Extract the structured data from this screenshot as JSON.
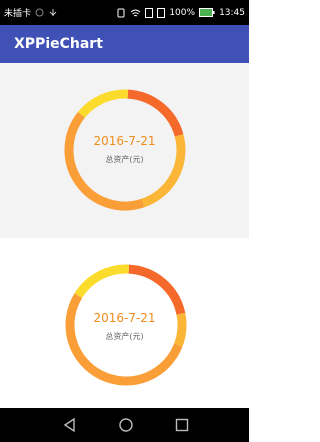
{
  "status_bar": {
    "carrier": "未插卡",
    "battery": "100%",
    "time": "13:45"
  },
  "app_bar": {
    "title": "XPPieChart"
  },
  "charts": [
    {
      "center_title": "2016-7-21",
      "center_subtitle": "总资产(元)",
      "slices": [
        {
          "value": 0.2,
          "color": "#f5692a"
        },
        {
          "value": 0.24,
          "color": "#fbb637"
        },
        {
          "value": 0.41,
          "color": "#fa9f38"
        },
        {
          "value": 0.15,
          "color": "#fbdb2c"
        }
      ]
    },
    {
      "center_title": "2016-7-21",
      "center_subtitle": "总资产(元)",
      "slices": [
        {
          "value": 0.21,
          "color": "#f5692a"
        },
        {
          "value": 0.09,
          "color": "#fbb637"
        },
        {
          "value": 0.53,
          "color": "#fa9f38"
        },
        {
          "value": 0.17,
          "color": "#fbdb2c"
        }
      ]
    }
  ],
  "nav_bar": {
    "buttons": [
      {
        "icon": "back-triangle-icon"
      },
      {
        "icon": "home-circle-icon"
      },
      {
        "icon": "recents-square-icon"
      }
    ]
  }
}
